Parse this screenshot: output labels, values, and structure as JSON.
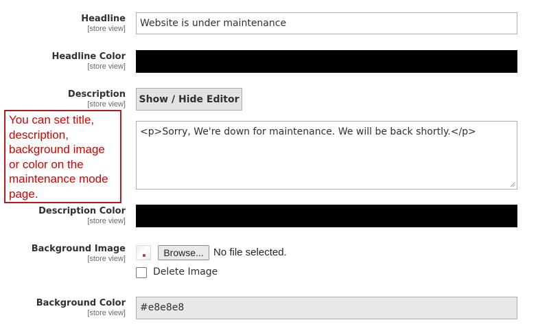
{
  "fields": {
    "headline": {
      "label": "Headline",
      "scope": "[store view]",
      "value": "Website is under maintenance"
    },
    "headline_color": {
      "label": "Headline Color",
      "scope": "[store view]",
      "color": "#000000"
    },
    "description": {
      "label": "Description",
      "scope": "[store view]",
      "editor_button": "Show / Hide Editor",
      "value": "<p>Sorry, We're down for maintenance. We will be back shortly.</p>"
    },
    "description_color": {
      "label": "Description Color",
      "scope": "[store view]",
      "color": "#000000"
    },
    "background_image": {
      "label": "Background Image",
      "scope": "[store view]",
      "browse_label": "Browse...",
      "file_status": "No file selected.",
      "delete_label": "Delete Image",
      "delete_checked": false
    },
    "background_color": {
      "label": "Background Color",
      "scope": "[store view]",
      "value": "#e8e8e8"
    }
  },
  "callout": {
    "text": "You can set title, description, background image or color on the maintenance mode page.",
    "border_color": "#b21a1a",
    "text_color": "#d40000"
  }
}
